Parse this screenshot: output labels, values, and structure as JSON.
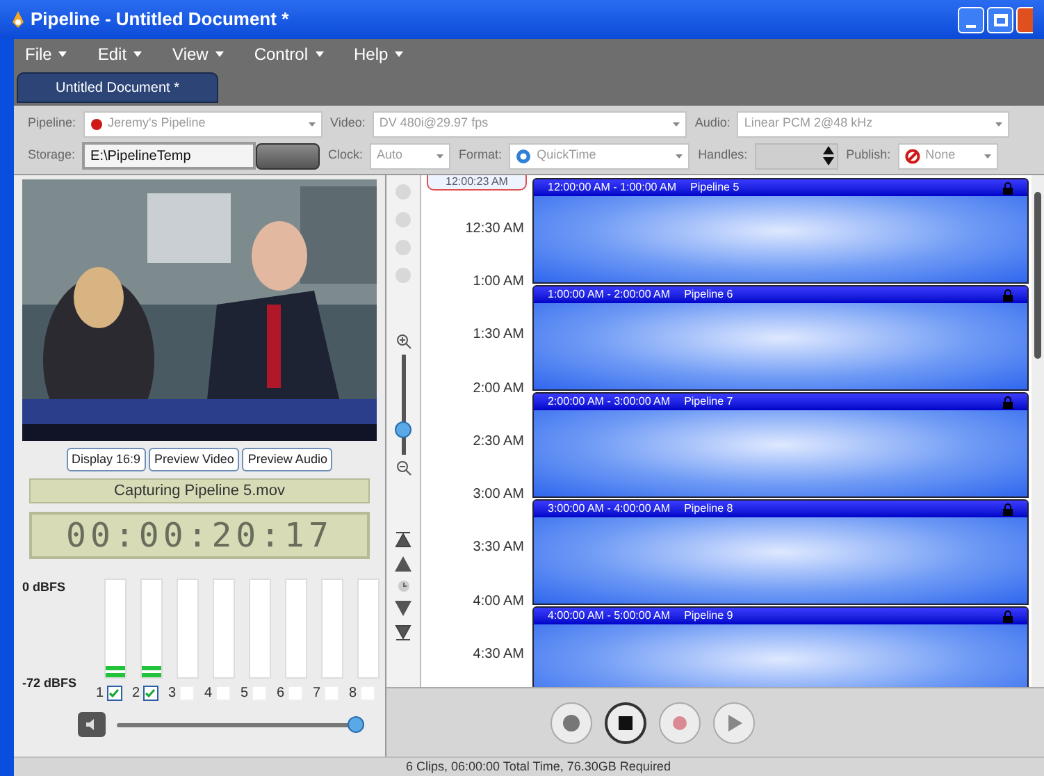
{
  "window": {
    "title": "Pipeline - Untitled Document *"
  },
  "menu": [
    {
      "label": "File"
    },
    {
      "label": "Edit"
    },
    {
      "label": "View"
    },
    {
      "label": "Control"
    },
    {
      "label": "Help"
    }
  ],
  "document_tabs": [
    {
      "label": "Untitled Document *",
      "selected": true
    }
  ],
  "settings_rows": [
    [
      {
        "kind": "dropdown",
        "label": "Pipeline:",
        "value": "Jeremy's Pipeline",
        "disabled": true
      },
      {
        "kind": "dropdown",
        "label": "Video:",
        "value": "DV 480i@29.97 fps",
        "disabled": true
      },
      {
        "kind": "dropdown",
        "label": "Audio:",
        "value": "Linear PCM 2@48 kHz",
        "disabled": true
      }
    ],
    [
      {
        "kind": "field",
        "label": "Storage:",
        "value": "E:\\PipelineTemp",
        "disabled": false
      },
      {
        "kind": "button",
        "disabled": false
      },
      {
        "kind": "dropdown",
        "label": "Clock:",
        "value": "Auto",
        "disabled": true
      },
      {
        "kind": "dropdown",
        "label": "Format:",
        "value": "QuickTime",
        "disabled": true
      },
      {
        "kind": "spinner",
        "label": "Handles:",
        "disabled": true
      },
      {
        "kind": "dropdown",
        "label": "Publish:",
        "value": "None",
        "disabled": true
      }
    ]
  ],
  "preview": {
    "kind": "picture"
  },
  "preview_buttons": [
    "Display 16:9",
    "Preview Video",
    "Preview Audio"
  ],
  "capture_status": "Capturing Pipeline 5.mov",
  "timecode": "00:00:20:17",
  "meters": {
    "top_label": "0 dBFS",
    "bottom_label": "-72 dBFS",
    "channels": [
      {
        "label": "1",
        "checked": true,
        "level": 0.12
      },
      {
        "label": "2",
        "checked": true,
        "level": 0.12
      },
      {
        "label": "3",
        "checked": false,
        "level": 0
      },
      {
        "label": "4",
        "checked": false,
        "level": 0
      },
      {
        "label": "5",
        "checked": false,
        "level": 0
      },
      {
        "label": "6",
        "checked": false,
        "level": 0
      },
      {
        "label": "7",
        "checked": false,
        "level": 0
      },
      {
        "label": "8",
        "checked": false,
        "level": 0
      }
    ]
  },
  "volume": {
    "level": 1
  },
  "timeline": {
    "current_time": "12:00:23 AM",
    "zoom": {
      "level": 0.25
    },
    "times": [
      "12:30 AM",
      "1:00 AM",
      "1:30 AM",
      "2:00 AM",
      "2:30 AM",
      "3:00 AM",
      "3:30 AM",
      "4:00 AM",
      "4:30 AM"
    ],
    "clips": [
      {
        "range": "12:00:00 AM - 1:00:00 AM",
        "name": "Pipeline 5",
        "locked": true
      },
      {
        "range": "1:00:00 AM - 2:00:00 AM",
        "name": "Pipeline 6",
        "locked": true
      },
      {
        "range": "2:00:00 AM - 3:00:00 AM",
        "name": "Pipeline 7",
        "locked": true
      },
      {
        "range": "3:00:00 AM - 4:00:00 AM",
        "name": "Pipeline 8",
        "locked": true
      },
      {
        "range": "4:00:00 AM - 5:00:00 AM",
        "name": "Pipeline 9",
        "locked": true
      }
    ]
  },
  "transport": [
    {
      "kind": "capture"
    },
    {
      "kind": "stop"
    },
    {
      "kind": "record"
    },
    {
      "kind": "play"
    }
  ],
  "status_bar": "6 Clips, 06:00:00 Total Time, 76.30GB Required"
}
